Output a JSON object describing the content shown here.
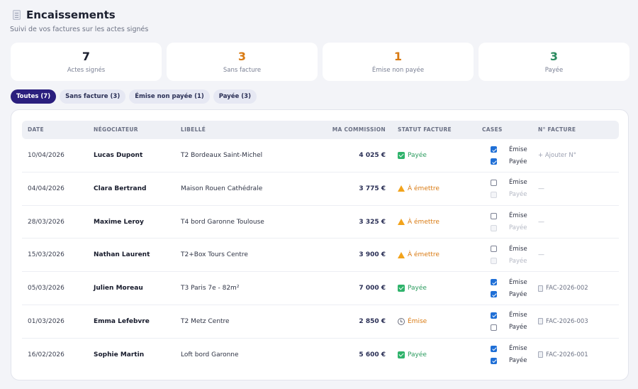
{
  "header": {
    "title": "Encaissements",
    "subtitle": "Suivi de vos factures sur les actes signés"
  },
  "stats": [
    {
      "value": "7",
      "label": "Actes signés",
      "color": "#1c2030"
    },
    {
      "value": "3",
      "label": "Sans facture",
      "color": "#d97a12"
    },
    {
      "value": "1",
      "label": "Émise non payée",
      "color": "#d97a12"
    },
    {
      "value": "3",
      "label": "Payée",
      "color": "#2a8a5e"
    }
  ],
  "tabs": [
    {
      "label": "Toutes (7)",
      "active": true
    },
    {
      "label": "Sans facture (3)",
      "active": false
    },
    {
      "label": "Émise non payée (1)",
      "active": false
    },
    {
      "label": "Payée (3)",
      "active": false
    }
  ],
  "table": {
    "columns": [
      "DATE",
      "NÉGOCIATEUR",
      "LIBELLÉ",
      "MA COMMISSION",
      "STATUT FACTURE",
      "CASES",
      "N° FACTURE"
    ],
    "checkbox_labels": {
      "emise": "Émise",
      "payee": "Payée"
    },
    "add_invoice_label": "+ Ajouter N°",
    "empty_invoice": "—",
    "rows": [
      {
        "date": "10/04/2026",
        "negociateur": "Lucas Dupont",
        "libelle": "T2 Bordeaux Saint-Michel",
        "commission": "4 025 €",
        "statut": "Payée",
        "statut_kind": "payee",
        "emise": true,
        "payee": true,
        "payee_disabled": false,
        "facture": "+ Ajouter N°",
        "facture_kind": "add"
      },
      {
        "date": "04/04/2026",
        "negociateur": "Clara Bertrand",
        "libelle": "Maison Rouen Cathédrale",
        "commission": "3 775 €",
        "statut": "À émettre",
        "statut_kind": "emettre",
        "emise": false,
        "payee": false,
        "payee_disabled": true,
        "facture": "—",
        "facture_kind": "none"
      },
      {
        "date": "28/03/2026",
        "negociateur": "Maxime Leroy",
        "libelle": "T4 bord Garonne Toulouse",
        "commission": "3 325 €",
        "statut": "À émettre",
        "statut_kind": "emettre",
        "emise": false,
        "payee": false,
        "payee_disabled": true,
        "facture": "—",
        "facture_kind": "none"
      },
      {
        "date": "15/03/2026",
        "negociateur": "Nathan Laurent",
        "libelle": "T2+Box Tours Centre",
        "commission": "3 900 €",
        "statut": "À émettre",
        "statut_kind": "emettre",
        "emise": false,
        "payee": false,
        "payee_disabled": true,
        "facture": "—",
        "facture_kind": "none"
      },
      {
        "date": "05/03/2026",
        "negociateur": "Julien Moreau",
        "libelle": "T3 Paris 7e - 82m²",
        "commission": "7 000 €",
        "statut": "Payée",
        "statut_kind": "payee",
        "emise": true,
        "payee": true,
        "payee_disabled": false,
        "facture": "FAC-2026-002",
        "facture_kind": "num"
      },
      {
        "date": "01/03/2026",
        "negociateur": "Emma Lefebvre",
        "libelle": "T2 Metz Centre",
        "commission": "2 850 €",
        "statut": "Émise",
        "statut_kind": "emise",
        "emise": true,
        "payee": false,
        "payee_disabled": false,
        "facture": "FAC-2026-003",
        "facture_kind": "num"
      },
      {
        "date": "16/02/2026",
        "negociateur": "Sophie Martin",
        "libelle": "Loft bord Garonne",
        "commission": "5 600 €",
        "statut": "Payée",
        "statut_kind": "payee",
        "emise": true,
        "payee": true,
        "payee_disabled": false,
        "facture": "FAC-2026-001",
        "facture_kind": "num"
      }
    ]
  }
}
